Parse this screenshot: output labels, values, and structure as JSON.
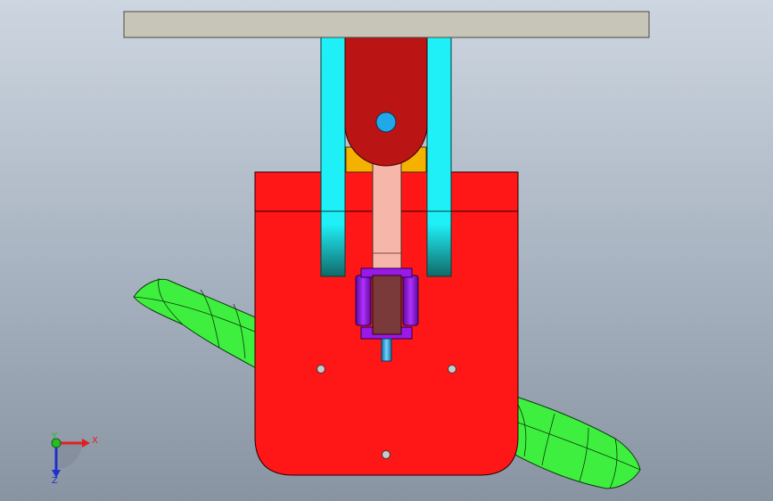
{
  "scene": {
    "colors": {
      "background_top": "#cdd6e0",
      "background_bottom": "#8994a3",
      "top_plate": "#c6c5b8",
      "pivot_arm": "#bb1414",
      "pivot_pin": "#22a8e8",
      "guide_rails": "#1ff0f8",
      "rail_tips": "#127a78",
      "yoke_block": "#f4b100",
      "body_plate": "#ff1616",
      "connecting_rod": "#f6b6aa",
      "clamp_ring": "#9a18e8",
      "clamp_core": "#7a3a3a",
      "shaft": "#2aa6e0",
      "fin": "#3fef3f",
      "holes": "#c9c9c9"
    }
  },
  "triad": {
    "x_label": "X",
    "y_label": "Y",
    "z_label": "Z",
    "x_color": "#e02020",
    "y_color": "#20c020",
    "z_color": "#2030d0"
  }
}
